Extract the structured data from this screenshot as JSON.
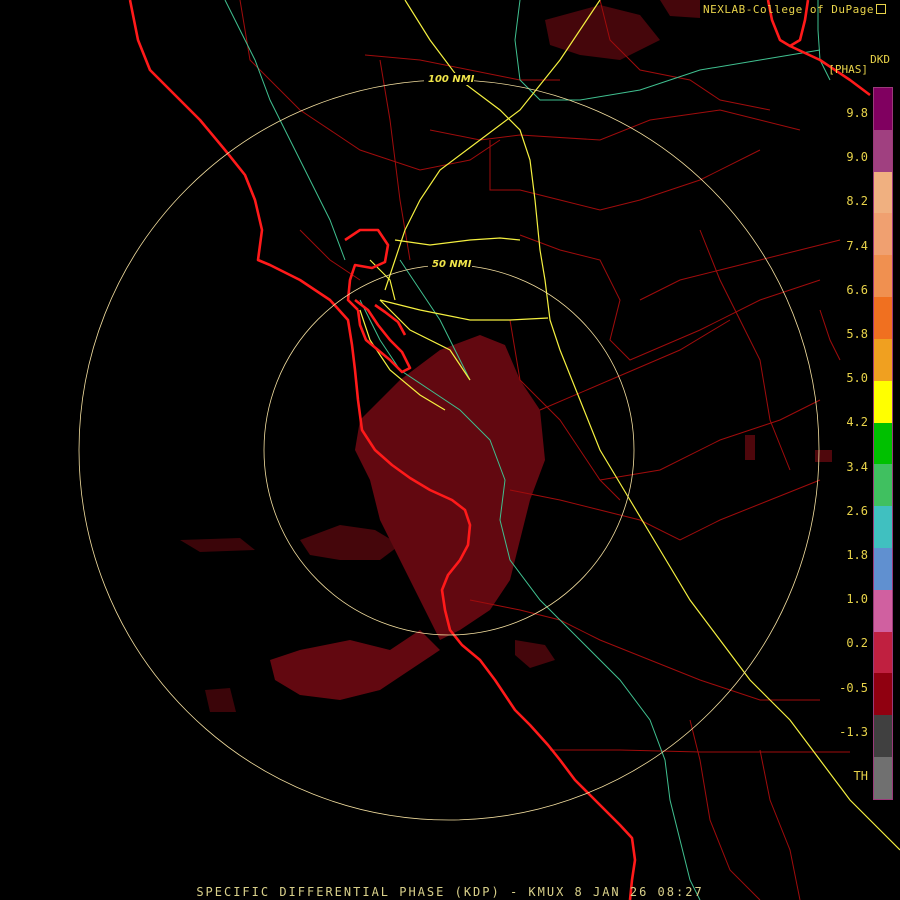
{
  "header": {
    "credit": "NEXLAB-College of DuPage",
    "credit_icon": "external-link-icon",
    "product_code": "DKD",
    "units": "[PHAS]"
  },
  "map": {
    "range_rings": [
      {
        "label": "100 NMI"
      },
      {
        "label": "50 NMI"
      }
    ],
    "colors": {
      "coastline": "#ff1a1a",
      "county_lines": "#b01010",
      "highways": "#ffff33",
      "rivers": "#40c090",
      "range_rings": "#f5e0a0",
      "echo": "#7a0a14"
    }
  },
  "legend": {
    "labels": [
      "9.8",
      "9.0",
      "8.2",
      "7.4",
      "6.6",
      "5.8",
      "5.0",
      "4.2",
      "3.4",
      "2.6",
      "1.8",
      "1.0",
      "0.2",
      "-0.5",
      "-1.3",
      "TH"
    ],
    "colors": [
      "#800060",
      "#a04080",
      "#f0b080",
      "#f0a070",
      "#f09050",
      "#f07020",
      "#f0a020",
      "#ffff00",
      "#00c000",
      "#40c060",
      "#40c0c0",
      "#6090d0",
      "#d060a0",
      "#c02040",
      "#900010",
      "#404040",
      "#707070"
    ]
  },
  "caption": "SPECIFIC DIFFERENTIAL PHASE (KDP) - KMUX 8 JAN 26 08:27"
}
